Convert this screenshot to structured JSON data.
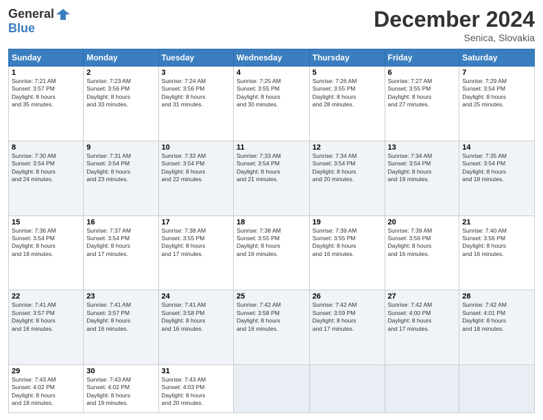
{
  "logo": {
    "general": "General",
    "blue": "Blue"
  },
  "title": "December 2024",
  "location": "Senica, Slovakia",
  "days_header": [
    "Sunday",
    "Monday",
    "Tuesday",
    "Wednesday",
    "Thursday",
    "Friday",
    "Saturday"
  ],
  "weeks": [
    [
      {
        "day": "1",
        "info": "Sunrise: 7:21 AM\nSunset: 3:57 PM\nDaylight: 8 hours\nand 35 minutes."
      },
      {
        "day": "2",
        "info": "Sunrise: 7:23 AM\nSunset: 3:56 PM\nDaylight: 8 hours\nand 33 minutes."
      },
      {
        "day": "3",
        "info": "Sunrise: 7:24 AM\nSunset: 3:56 PM\nDaylight: 8 hours\nand 31 minutes."
      },
      {
        "day": "4",
        "info": "Sunrise: 7:25 AM\nSunset: 3:55 PM\nDaylight: 8 hours\nand 30 minutes."
      },
      {
        "day": "5",
        "info": "Sunrise: 7:26 AM\nSunset: 3:55 PM\nDaylight: 8 hours\nand 28 minutes."
      },
      {
        "day": "6",
        "info": "Sunrise: 7:27 AM\nSunset: 3:55 PM\nDaylight: 8 hours\nand 27 minutes."
      },
      {
        "day": "7",
        "info": "Sunrise: 7:29 AM\nSunset: 3:54 PM\nDaylight: 8 hours\nand 25 minutes."
      }
    ],
    [
      {
        "day": "8",
        "info": "Sunrise: 7:30 AM\nSunset: 3:54 PM\nDaylight: 8 hours\nand 24 minutes."
      },
      {
        "day": "9",
        "info": "Sunrise: 7:31 AM\nSunset: 3:54 PM\nDaylight: 8 hours\nand 23 minutes."
      },
      {
        "day": "10",
        "info": "Sunrise: 7:32 AM\nSunset: 3:54 PM\nDaylight: 8 hours\nand 22 minutes."
      },
      {
        "day": "11",
        "info": "Sunrise: 7:33 AM\nSunset: 3:54 PM\nDaylight: 8 hours\nand 21 minutes."
      },
      {
        "day": "12",
        "info": "Sunrise: 7:34 AM\nSunset: 3:54 PM\nDaylight: 8 hours\nand 20 minutes."
      },
      {
        "day": "13",
        "info": "Sunrise: 7:34 AM\nSunset: 3:54 PM\nDaylight: 8 hours\nand 19 minutes."
      },
      {
        "day": "14",
        "info": "Sunrise: 7:35 AM\nSunset: 3:54 PM\nDaylight: 8 hours\nand 18 minutes."
      }
    ],
    [
      {
        "day": "15",
        "info": "Sunrise: 7:36 AM\nSunset: 3:54 PM\nDaylight: 8 hours\nand 18 minutes."
      },
      {
        "day": "16",
        "info": "Sunrise: 7:37 AM\nSunset: 3:54 PM\nDaylight: 8 hours\nand 17 minutes."
      },
      {
        "day": "17",
        "info": "Sunrise: 7:38 AM\nSunset: 3:55 PM\nDaylight: 8 hours\nand 17 minutes."
      },
      {
        "day": "18",
        "info": "Sunrise: 7:38 AM\nSunset: 3:55 PM\nDaylight: 8 hours\nand 16 minutes."
      },
      {
        "day": "19",
        "info": "Sunrise: 7:39 AM\nSunset: 3:55 PM\nDaylight: 8 hours\nand 16 minutes."
      },
      {
        "day": "20",
        "info": "Sunrise: 7:39 AM\nSunset: 3:56 PM\nDaylight: 8 hours\nand 16 minutes."
      },
      {
        "day": "21",
        "info": "Sunrise: 7:40 AM\nSunset: 3:56 PM\nDaylight: 8 hours\nand 16 minutes."
      }
    ],
    [
      {
        "day": "22",
        "info": "Sunrise: 7:41 AM\nSunset: 3:57 PM\nDaylight: 8 hours\nand 16 minutes."
      },
      {
        "day": "23",
        "info": "Sunrise: 7:41 AM\nSunset: 3:57 PM\nDaylight: 8 hours\nand 16 minutes."
      },
      {
        "day": "24",
        "info": "Sunrise: 7:41 AM\nSunset: 3:58 PM\nDaylight: 8 hours\nand 16 minutes."
      },
      {
        "day": "25",
        "info": "Sunrise: 7:42 AM\nSunset: 3:58 PM\nDaylight: 8 hours\nand 16 minutes."
      },
      {
        "day": "26",
        "info": "Sunrise: 7:42 AM\nSunset: 3:59 PM\nDaylight: 8 hours\nand 17 minutes."
      },
      {
        "day": "27",
        "info": "Sunrise: 7:42 AM\nSunset: 4:00 PM\nDaylight: 8 hours\nand 17 minutes."
      },
      {
        "day": "28",
        "info": "Sunrise: 7:42 AM\nSunset: 4:01 PM\nDaylight: 8 hours\nand 18 minutes."
      }
    ],
    [
      {
        "day": "29",
        "info": "Sunrise: 7:43 AM\nSunset: 4:02 PM\nDaylight: 8 hours\nand 18 minutes."
      },
      {
        "day": "30",
        "info": "Sunrise: 7:43 AM\nSunset: 4:02 PM\nDaylight: 8 hours\nand 19 minutes."
      },
      {
        "day": "31",
        "info": "Sunrise: 7:43 AM\nSunset: 4:03 PM\nDaylight: 8 hours\nand 20 minutes."
      },
      null,
      null,
      null,
      null
    ]
  ]
}
